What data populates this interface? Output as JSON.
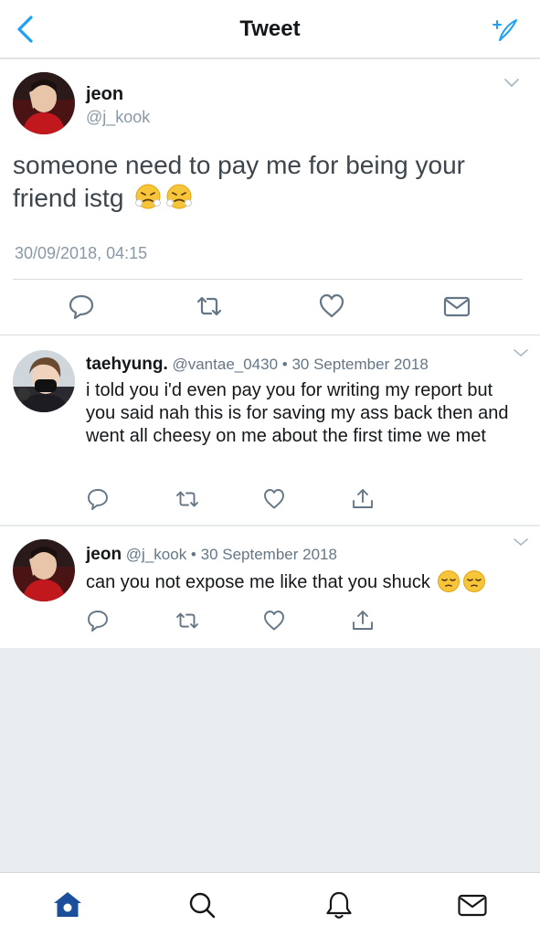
{
  "nav": {
    "title": "Tweet",
    "back_icon": "chevron-left-icon",
    "compose_icon": "compose-sparkle-icon",
    "accent": "#1da1f2"
  },
  "main_tweet": {
    "name": "jeon",
    "handle": "@j_kook",
    "text": "someone need to pay me for being your friend istg",
    "emoji": [
      "steam-from-nose",
      "steam-from-nose"
    ],
    "date": "30/09/2018, 04:15"
  },
  "replies": [
    {
      "name": "taehyung.",
      "handle": "@vantae_0430",
      "date": "30 September 2018",
      "text": "i told you i'd even pay you for writing my report but you said nah this is for saving my ass back then and went all cheesy on me about the first time we met"
    },
    {
      "name": "jeon",
      "handle": "@j_kook",
      "date": "30 September 2018",
      "text": "can you not expose me like that you shuck",
      "emoji": [
        "pensive-face",
        "pensive-face"
      ]
    }
  ],
  "meta_separator": " • ",
  "tabbar": {
    "items": [
      "home-icon",
      "search-icon",
      "notifications-icon",
      "messages-icon"
    ],
    "active": "home-icon"
  }
}
